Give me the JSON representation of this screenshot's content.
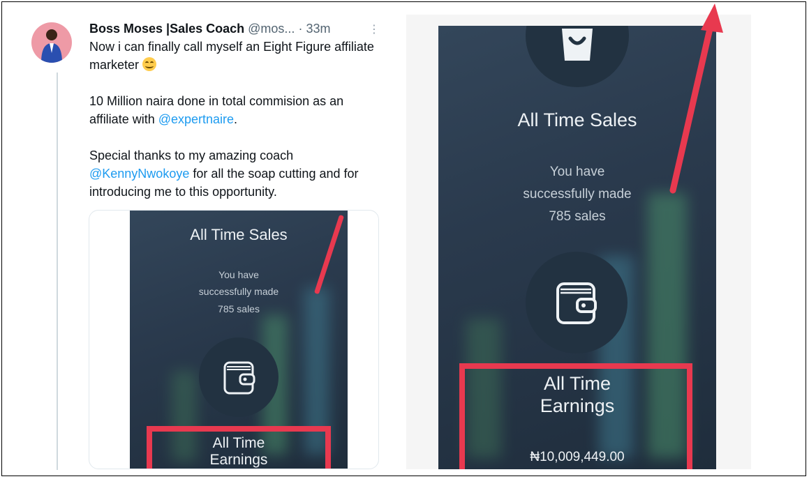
{
  "tweet": {
    "author_name": "Boss Moses |Sales Coach",
    "author_handle": "@mos...",
    "time": "· 33m",
    "more": "⋮",
    "line1": "Now i can finally call myself an Eight Figure affiliate marketer",
    "p2_before": "10 Million naira done in total commision as an affiliate with ",
    "p2_mention": "@expertnaire",
    "p2_after": ".",
    "p3_before": "Special thanks to my amazing coach ",
    "p3_mention": "@KennyNwokoye",
    "p3_after": " for all the soap cutting and for introducing me to this opportunity."
  },
  "left_screen": {
    "title": "All Time Sales",
    "sub1": "You have",
    "sub2": "successfully made",
    "sub3": "785 sales",
    "earnings1": "All Time",
    "earnings2": "Earnings"
  },
  "right_screen": {
    "title": "All Time Sales",
    "sub1": "You have",
    "sub2": "successfully made",
    "sub3": "785 sales",
    "earnings1": "All Time",
    "earnings2": "Earnings",
    "amount": "₦10,009,449.00"
  },
  "colors": {
    "highlight_red": "#e8394f",
    "mention_blue": "#1d9bf0",
    "screen_bg": "#2a3a4d"
  }
}
